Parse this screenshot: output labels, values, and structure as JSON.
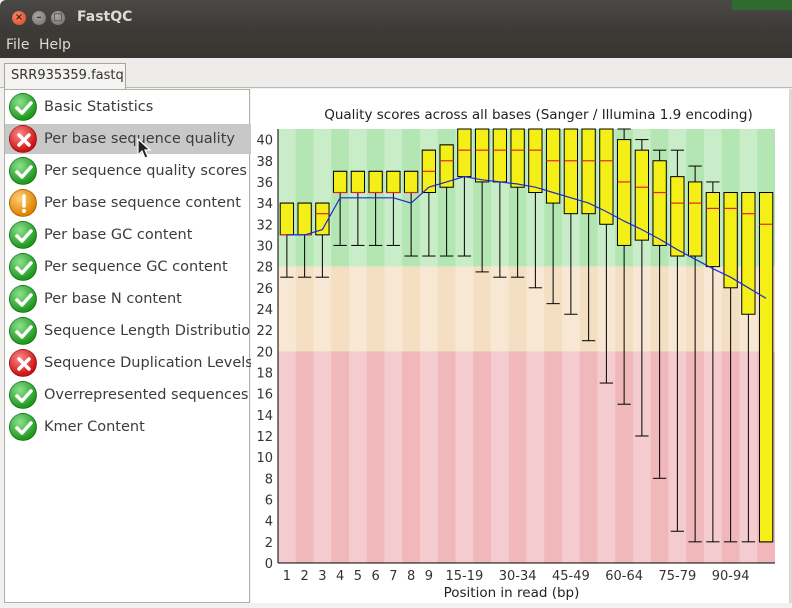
{
  "window": {
    "title": "FastQC",
    "buttons": {
      "close": "×",
      "minimize": "–",
      "maximize": "□"
    }
  },
  "menu": {
    "file": "File",
    "help": "Help"
  },
  "tab": {
    "label": "SRR935359.fastq"
  },
  "modules": [
    {
      "label": "Basic Statistics",
      "status": "pass",
      "selected": false
    },
    {
      "label": "Per base sequence quality",
      "status": "fail",
      "selected": true
    },
    {
      "label": "Per sequence quality scores",
      "status": "pass",
      "selected": false
    },
    {
      "label": "Per base sequence content",
      "status": "warn",
      "selected": false
    },
    {
      "label": "Per base GC content",
      "status": "pass",
      "selected": false
    },
    {
      "label": "Per sequence GC content",
      "status": "pass",
      "selected": false
    },
    {
      "label": "Per base N content",
      "status": "pass",
      "selected": false
    },
    {
      "label": "Sequence Length Distribution",
      "status": "pass",
      "selected": false
    },
    {
      "label": "Sequence Duplication Levels",
      "status": "fail",
      "selected": false
    },
    {
      "label": "Overrepresented sequences",
      "status": "pass",
      "selected": false
    },
    {
      "label": "Kmer Content",
      "status": "pass",
      "selected": false
    }
  ],
  "colors": {
    "good_zone": "#b3e6b3",
    "ok_zone": "#f5dfc2",
    "poor_zone": "#f0b8bb",
    "box_fill": "#f5ef18",
    "median_line": "#e0262a",
    "mean_line": "#1f2bd1"
  },
  "chart_data": {
    "type": "box",
    "title": "Quality scores across all bases (Sanger / Illumina 1.9 encoding)",
    "xlabel": "Position in read (bp)",
    "ylabel": "",
    "ylim": [
      0,
      41
    ],
    "yticks": [
      0,
      2,
      4,
      6,
      8,
      10,
      12,
      14,
      16,
      18,
      20,
      22,
      24,
      26,
      28,
      30,
      32,
      34,
      36,
      38,
      40
    ],
    "x_tick_labels": [
      "1",
      "2",
      "3",
      "4",
      "5",
      "6",
      "7",
      "8",
      "9",
      "15-19",
      "30-34",
      "45-49",
      "60-64",
      "75-79",
      "90-94"
    ],
    "categories": [
      "1",
      "2",
      "3",
      "4",
      "5",
      "6",
      "7",
      "8",
      "9",
      "10-14",
      "15-19",
      "20-24",
      "25-29",
      "30-34",
      "35-39",
      "40-44",
      "45-49",
      "50-54",
      "55-59",
      "60-64",
      "65-69",
      "70-74",
      "75-79",
      "80-84",
      "85-89",
      "90-94",
      "95-99",
      "100-101"
    ],
    "zones": [
      {
        "name": "good",
        "from": 28,
        "to": 41
      },
      {
        "name": "ok",
        "from": 20,
        "to": 28
      },
      {
        "name": "poor",
        "from": 0,
        "to": 20
      }
    ],
    "boxes": [
      {
        "q1": 31,
        "median": 31,
        "q3": 34,
        "lower": 27,
        "upper": 34
      },
      {
        "q1": 31,
        "median": 31,
        "q3": 34,
        "lower": 27,
        "upper": 34
      },
      {
        "q1": 31,
        "median": 33,
        "q3": 34,
        "lower": 27,
        "upper": 34
      },
      {
        "q1": 35,
        "median": 35,
        "q3": 37,
        "lower": 30,
        "upper": 37
      },
      {
        "q1": 35,
        "median": 35,
        "q3": 37,
        "lower": 30,
        "upper": 37
      },
      {
        "q1": 35,
        "median": 35,
        "q3": 37,
        "lower": 30,
        "upper": 37
      },
      {
        "q1": 35,
        "median": 35,
        "q3": 37,
        "lower": 30,
        "upper": 37
      },
      {
        "q1": 35,
        "median": 35,
        "q3": 37,
        "lower": 29,
        "upper": 37
      },
      {
        "q1": 35,
        "median": 37,
        "q3": 39,
        "lower": 29,
        "upper": 39
      },
      {
        "q1": 35.5,
        "median": 38,
        "q3": 39.5,
        "lower": 29,
        "upper": 39.5
      },
      {
        "q1": 36.5,
        "median": 39,
        "q3": 41,
        "lower": 29,
        "upper": 41
      },
      {
        "q1": 36,
        "median": 39,
        "q3": 41,
        "lower": 27.5,
        "upper": 41
      },
      {
        "q1": 36,
        "median": 39,
        "q3": 41,
        "lower": 27,
        "upper": 41
      },
      {
        "q1": 35.5,
        "median": 39,
        "q3": 41,
        "lower": 27,
        "upper": 41
      },
      {
        "q1": 35,
        "median": 39,
        "q3": 41,
        "lower": 26,
        "upper": 41
      },
      {
        "q1": 34,
        "median": 38,
        "q3": 41,
        "lower": 24.5,
        "upper": 41
      },
      {
        "q1": 33,
        "median": 38,
        "q3": 41,
        "lower": 23.5,
        "upper": 41
      },
      {
        "q1": 33,
        "median": 38,
        "q3": 41,
        "lower": 21,
        "upper": 41
      },
      {
        "q1": 32,
        "median": 38,
        "q3": 41,
        "lower": 17,
        "upper": 41
      },
      {
        "q1": 30,
        "median": 36,
        "q3": 40,
        "lower": 15,
        "upper": 41
      },
      {
        "q1": 30.5,
        "median": 35.5,
        "q3": 39,
        "lower": 12,
        "upper": 40
      },
      {
        "q1": 30,
        "median": 35,
        "q3": 38,
        "lower": 8,
        "upper": 39
      },
      {
        "q1": 29,
        "median": 34,
        "q3": 36.5,
        "lower": 3,
        "upper": 39
      },
      {
        "q1": 29,
        "median": 34,
        "q3": 36,
        "lower": 2,
        "upper": 37.5
      },
      {
        "q1": 28,
        "median": 33.5,
        "q3": 35,
        "lower": 2,
        "upper": 36
      },
      {
        "q1": 26,
        "median": 33.5,
        "q3": 35,
        "lower": 2,
        "upper": 35
      },
      {
        "q1": 23.5,
        "median": 33,
        "q3": 35,
        "lower": 2,
        "upper": 35
      },
      {
        "q1": 2,
        "median": 32,
        "q3": 35,
        "lower": 2,
        "upper": 35
      }
    ],
    "mean": [
      31,
      31,
      31.5,
      34.5,
      34.5,
      34.5,
      34.5,
      34,
      35.5,
      36,
      36.5,
      36.2,
      36,
      35.8,
      35.5,
      35,
      34.5,
      34,
      33.2,
      32.3,
      31.5,
      30.6,
      29.6,
      28.7,
      27.8,
      27,
      26,
      25
    ]
  }
}
